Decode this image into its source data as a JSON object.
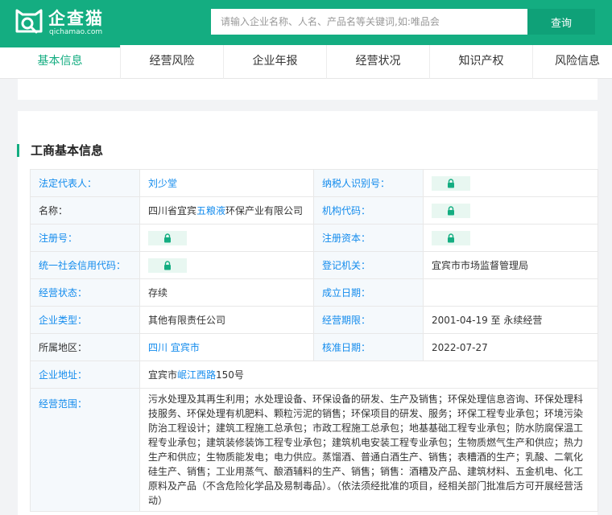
{
  "header": {
    "logo_name": "企查猫",
    "logo_domain": "qichamao.com",
    "search_placeholder": "请输入企业名称、人名、产品名等关键词,如:唯品会",
    "search_button": "查询"
  },
  "tabs": [
    {
      "label": "基本信息",
      "active": true
    },
    {
      "label": "经营风险"
    },
    {
      "label": "企业年报"
    },
    {
      "label": "经营状况"
    },
    {
      "label": "知识产权"
    },
    {
      "label": "风险信息"
    }
  ],
  "section": {
    "title": "工商基本信息"
  },
  "info": {
    "legal_rep_label": "法定代表人：",
    "legal_rep_value": "刘少堂",
    "taxpayer_id_label": "纳税人识别号：",
    "name_label": "名称：",
    "name_prefix": "四川省宜宾",
    "name_link": "五粮液",
    "name_suffix": "环保产业有限公司",
    "org_code_label": "机构代码：",
    "reg_no_label": "注册号：",
    "reg_capital_label": "注册资本：",
    "credit_code_label": "统一社会信用代码：",
    "reg_authority_label": "登记机关：",
    "reg_authority_value": "宜宾市市场监督管理局",
    "status_label": "经营状态：",
    "status_value": "存续",
    "founded_label": "成立日期：",
    "type_label": "企业类型：",
    "type_value": "其他有限责任公司",
    "period_label": "经营期限：",
    "period_value": "2001-04-19 至 永续经营",
    "region_label": "所属地区：",
    "region_province": "四川",
    "region_city": "宜宾市",
    "approval_label": "核准日期：",
    "approval_value": "2022-07-27",
    "address_label": "企业地址：",
    "address_prefix": "宜宾市",
    "address_link": "岷江西路",
    "address_suffix": "150号",
    "scope_label": "经营范围：",
    "scope_value": "污水处理及其再生利用；水处理设备、环保设备的研发、生产及销售；环保处理信息咨询、环保处理科技服务、环保处理有机肥料、颗粒污泥的销售；环保项目的研发、服务；环保工程专业承包；环境污染防治工程设计；建筑工程施工总承包；市政工程施工总承包；地基基础工程专业承包；防水防腐保温工程专业承包；建筑装修装饰工程专业承包；建筑机电安装工程专业承包；生物质燃气生产和供应；热力生产和供应；生物质能发电；电力供应。蒸馏酒、普通白酒生产、销售；表糟酒的生产；乳酸、二氧化硅生产、销售；工业用蒸气、酿酒辅料的生产、销售；销售：酒糟及产品、建筑材料、五金机电、化工原料及产品（不含危险化学品及易制毒品）。（依法须经批准的项目，经相关部门批准后方可开展经营活动）"
  },
  "colors": {
    "brand": "#14ad81",
    "link": "#128bed",
    "label_bg": "#f5f9fc"
  },
  "icons": {
    "locked_field": "lock-icon"
  }
}
